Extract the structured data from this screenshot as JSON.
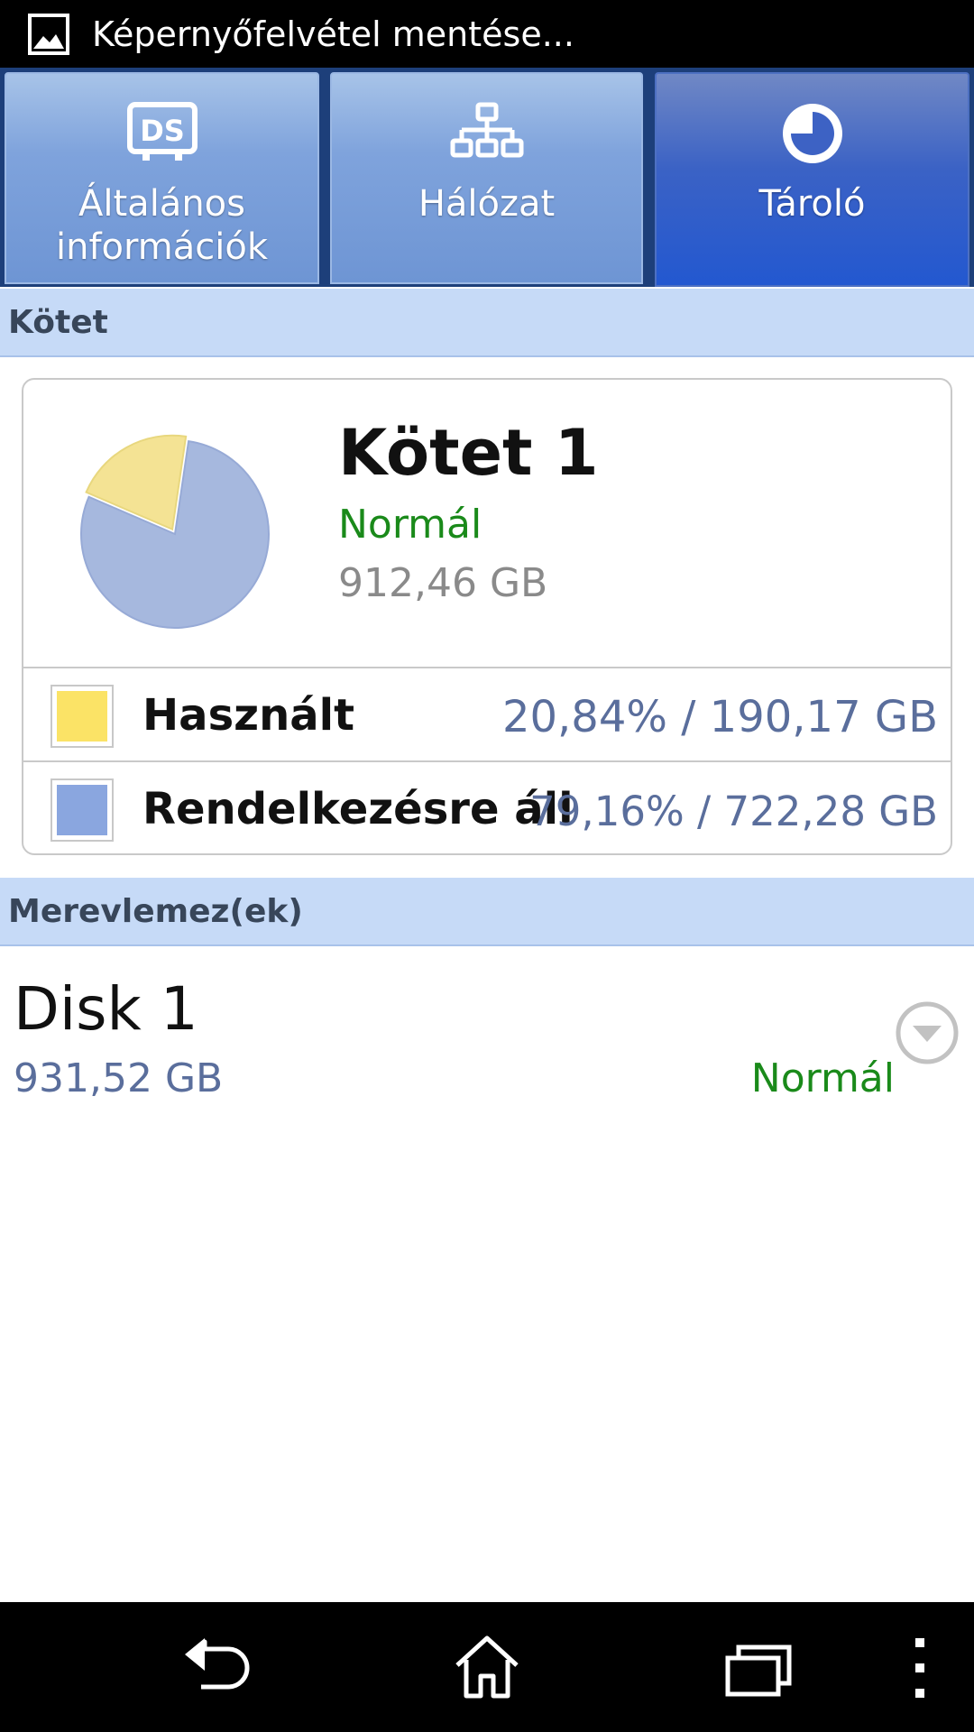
{
  "status_bar": {
    "notification_icon": "image-icon",
    "text": "Képernyőfelvétel mentése..."
  },
  "tabs": [
    {
      "icon": "ds-icon",
      "label_line1": "Általános",
      "label_line2": "információk",
      "active": false
    },
    {
      "icon": "network-icon",
      "label_line1": "Hálózat",
      "active": false
    },
    {
      "icon": "pie-chart-icon",
      "label_line1": "Tároló",
      "active": true
    }
  ],
  "volume_section": {
    "header": "Kötet",
    "volume": {
      "name": "Kötet 1",
      "status": "Normál",
      "size": "912,46 GB",
      "legend": [
        {
          "label": "Használt",
          "value": "20,84% / 190,17 GB",
          "color": "#fbe366"
        },
        {
          "label": "Rendelkezésre áll",
          "value": "79,16% / 722,28 GB",
          "color": "#8aa6df"
        }
      ]
    }
  },
  "chart_data": {
    "type": "pie",
    "categories": [
      "Használt",
      "Rendelkezésre áll"
    ],
    "values": [
      20.84,
      79.16
    ],
    "colors": [
      "#f4e394",
      "#a6b8de"
    ],
    "title": ""
  },
  "disk_section": {
    "header": "Merevlemez(ek)",
    "disks": [
      {
        "name": "Disk 1",
        "size": "931,52 GB",
        "status": "Normál",
        "expand_icon": "chevron-down-circle-icon"
      }
    ]
  },
  "nav_bar": {
    "buttons": [
      "back-icon",
      "home-icon",
      "recent-apps-icon",
      "overflow-menu-icon"
    ]
  },
  "colors": {
    "status_ok": "#1a8a1a",
    "value_text": "#5a6e9c",
    "section_header_bg": "#c6daf7",
    "tab_active": "#2358d0"
  }
}
